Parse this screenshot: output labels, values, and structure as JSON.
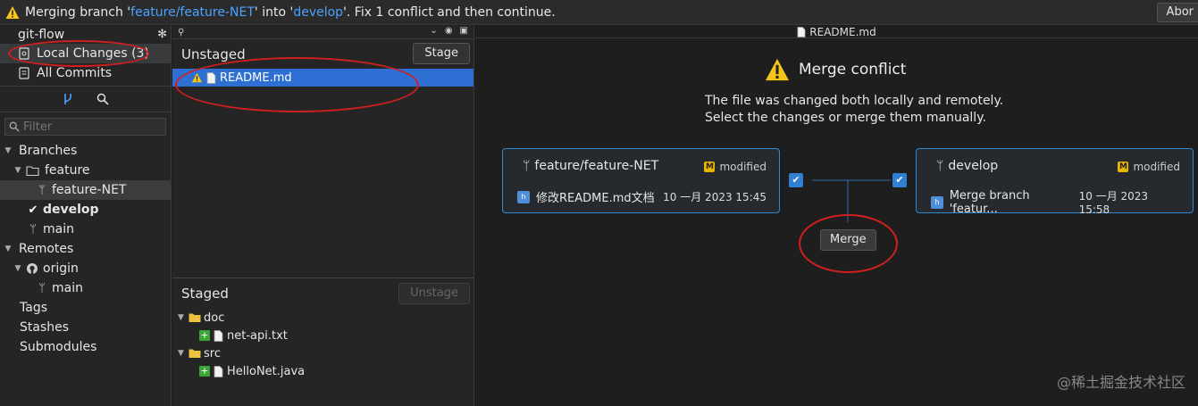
{
  "banner": {
    "prefix": "Merging branch '",
    "source_branch": "feature/feature-NET",
    "middle": "' into '",
    "target_branch": "develop",
    "suffix": "'. Fix 1 conflict and then continue.",
    "abort_label": "Abor"
  },
  "sidebar": {
    "repo_name": "git-flow",
    "nav": [
      {
        "label": "Local Changes (3)"
      },
      {
        "label": "All Commits"
      }
    ],
    "filter_placeholder": "Filter",
    "tree": {
      "branches_label": "Branches",
      "feature_folder": "feature",
      "feature_net": "feature-NET",
      "develop": "develop",
      "main": "main",
      "remotes_label": "Remotes",
      "origin": "origin",
      "origin_main": "main",
      "tags_label": "Tags",
      "stashes_label": "Stashes",
      "submodules_label": "Submodules"
    }
  },
  "unstaged": {
    "title": "Unstaged",
    "stage_button": "Stage",
    "files": [
      {
        "name": "README.md"
      }
    ]
  },
  "staged": {
    "title": "Staged",
    "unstage_button": "Unstage",
    "folders": [
      {
        "name": "doc",
        "files": [
          "net-api.txt"
        ]
      },
      {
        "name": "src",
        "files": [
          "HelloNet.java"
        ]
      }
    ]
  },
  "merge_panel": {
    "file_title": "README.md",
    "heading": "Merge conflict",
    "desc_line1": "The file was changed both locally and remotely.",
    "desc_line2": "Select the changes or merge them manually.",
    "left_card": {
      "branch": "feature/feature-NET",
      "status": "modified",
      "commit_message": "修改README.md文档",
      "commit_date": "10 一月 2023 15:45"
    },
    "right_card": {
      "branch": "develop",
      "status": "modified",
      "commit_message": "Merge branch 'featur...",
      "commit_date": "10 一月 2023 15:58"
    },
    "merge_button": "Merge"
  },
  "watermark": "@稀土掘金技术社区",
  "colors": {
    "accent": "#2d8ad6",
    "selection": "#2d6fd2",
    "annotation_red": "#d0201e",
    "warning": "#f5c518"
  }
}
